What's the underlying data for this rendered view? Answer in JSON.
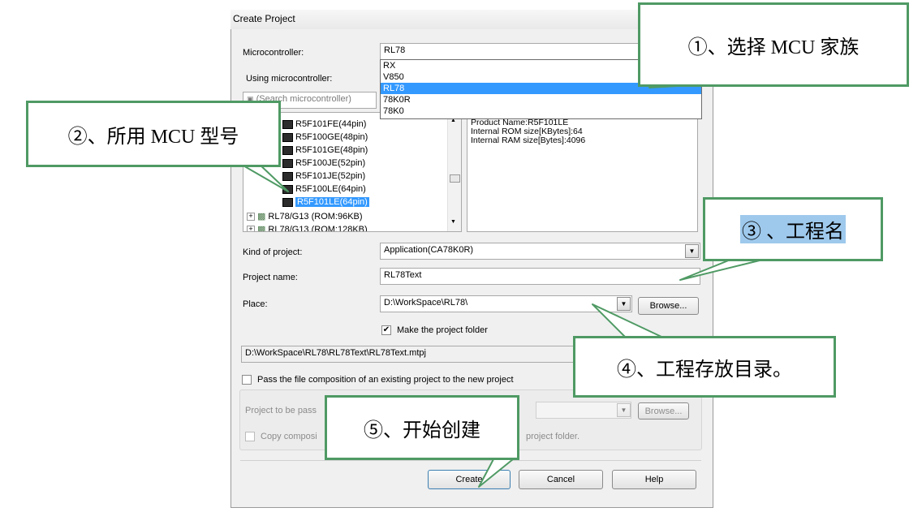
{
  "window": {
    "title": "Create Project"
  },
  "microcontroller": {
    "label": "Microcontroller:",
    "value": "RL78",
    "options": [
      "RX",
      "V850",
      "RL78",
      "78K0R",
      "78K0"
    ],
    "selected_option": "RL78"
  },
  "using_label": "Using microcontroller:",
  "search": {
    "placeholder": "(Search microcontroller)"
  },
  "tree": {
    "items": [
      "R5F101FE(44pin)",
      "R5F100GE(48pin)",
      "R5F101GE(48pin)",
      "R5F100JE(52pin)",
      "R5F101JE(52pin)",
      "R5F100LE(64pin)",
      "R5F101LE(64pin)"
    ],
    "selected": "R5F101LE(64pin)",
    "groups": [
      "RL78/G13 (ROM:96KB)",
      "RL78/G13 (ROM:128KB)"
    ]
  },
  "info": {
    "lines": [
      "Product Name:R5F101LE",
      "Internal ROM size[KBytes]:64",
      "Internal RAM size[Bytes]:4096"
    ]
  },
  "kind": {
    "label": "Kind of project:",
    "value": "Application(CA78K0R)"
  },
  "project_name": {
    "label": "Project name:",
    "value": "RL78Text"
  },
  "place": {
    "label": "Place:",
    "value": "D:\\WorkSpace\\RL78\\",
    "browse": "Browse..."
  },
  "make_folder": {
    "label": "Make the project folder",
    "checked": true
  },
  "full_path": "D:\\WorkSpace\\RL78\\RL78Text\\RL78Text.mtpj",
  "pass_composition": {
    "label": "Pass the file composition of an existing project to the new project",
    "checked": false
  },
  "pass_project": {
    "label": "Project to be pass",
    "browse": "Browse..."
  },
  "copy_composition": {
    "label_start": "Copy composi",
    "label_end": "project folder."
  },
  "buttons": {
    "create": "Create",
    "cancel": "Cancel",
    "help": "Help"
  },
  "callouts": {
    "c1": "①、选择 MCU 家族",
    "c2": "②、所用 MCU 型号",
    "c3": "③ 、工程名",
    "c4": "④、工程存放目录。",
    "c5": "⑤、开始创建"
  },
  "colors": {
    "callout_border": "#4f9a64",
    "selection": "#3399ff",
    "callout3_highlight": "#9ec9ec"
  }
}
